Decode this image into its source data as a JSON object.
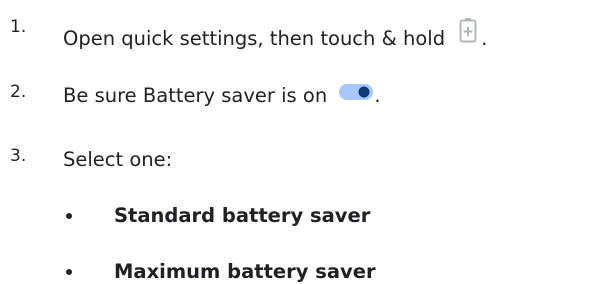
{
  "steps": [
    {
      "number": "1.",
      "before": "Open quick settings, then touch & hold",
      "after": ".",
      "icon": "battery-saver-icon"
    },
    {
      "number": "2.",
      "before": "Be sure Battery saver is on",
      "after": ".",
      "icon": "toggle-on-icon"
    },
    {
      "number": "3.",
      "text": "Select one:"
    }
  ],
  "options": [
    {
      "label": "Standard battery saver"
    },
    {
      "label": "Maximum battery saver"
    }
  ],
  "colors": {
    "text": "#202124",
    "icon_gray": "#b0b6bc",
    "toggle_track": "#a8c7fa",
    "toggle_thumb": "#0b3a74"
  }
}
